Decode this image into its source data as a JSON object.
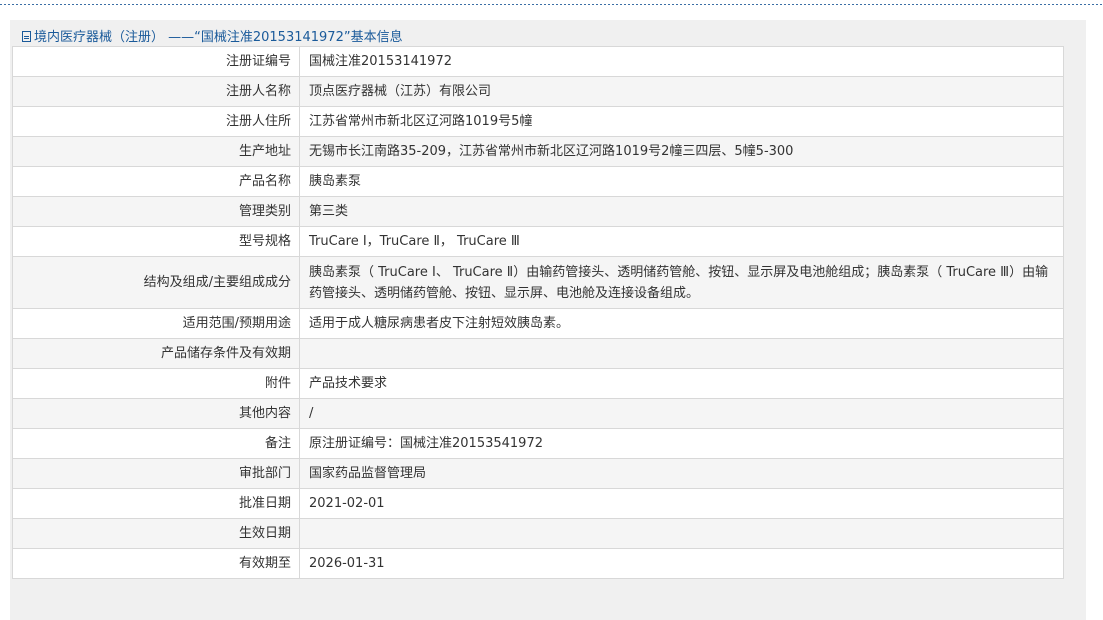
{
  "header": {
    "title": "境内医疗器械（注册） ——“国械注准20153141972”基本信息"
  },
  "rows": [
    {
      "label": "注册证编号",
      "value": "国械注准20153141972"
    },
    {
      "label": "注册人名称",
      "value": "顶点医疗器械（江苏）有限公司"
    },
    {
      "label": "注册人住所",
      "value": "江苏省常州市新北区辽河路1019号5幢"
    },
    {
      "label": "生产地址",
      "value": "无锡市长江南路35-209，江苏省常州市新北区辽河路1019号2幢三四层、5幢5-300"
    },
    {
      "label": "产品名称",
      "value": "胰岛素泵"
    },
    {
      "label": "管理类别",
      "value": "第三类"
    },
    {
      "label": "型号规格",
      "value": "TruCare Ⅰ，TruCare Ⅱ， TruCare Ⅲ"
    },
    {
      "label": "结构及组成/主要组成成分",
      "value": "胰岛素泵（ TruCare Ⅰ、 TruCare Ⅱ）由输药管接头、透明储药管舱、按钮、显示屏及电池舱组成；胰岛素泵（ TruCare Ⅲ）由输药管接头、透明储药管舱、按钮、显示屏、电池舱及连接设备组成。"
    },
    {
      "label": "适用范围/预期用途",
      "value": "适用于成人糖尿病患者皮下注射短效胰岛素。"
    },
    {
      "label": "产品储存条件及有效期",
      "value": ""
    },
    {
      "label": "附件",
      "value": "产品技术要求"
    },
    {
      "label": "其他内容",
      "value": "/"
    },
    {
      "label": "备注",
      "value": "原注册证编号：国械注准20153541972"
    },
    {
      "label": "审批部门",
      "value": "国家药品监督管理局"
    },
    {
      "label": "批准日期",
      "value": "2021-02-01"
    },
    {
      "label": "生效日期",
      "value": ""
    },
    {
      "label": "有效期至",
      "value": "2026-01-31"
    }
  ]
}
